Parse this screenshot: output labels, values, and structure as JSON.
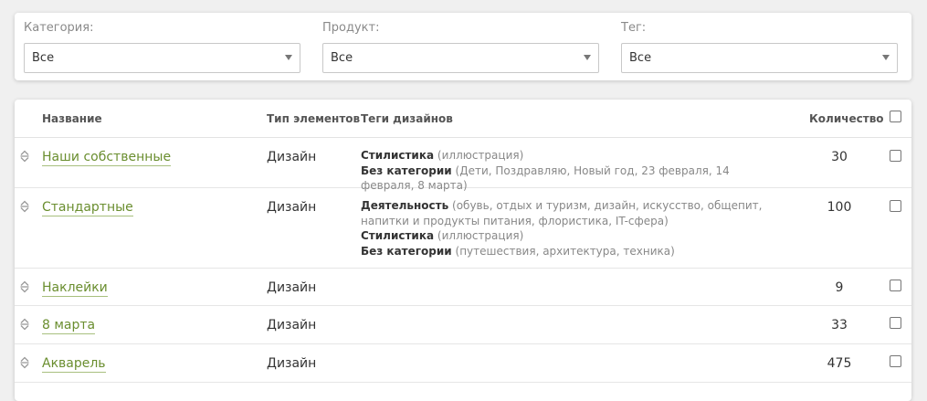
{
  "filters": {
    "category": {
      "label": "Категория:",
      "value": "Все"
    },
    "product": {
      "label": "Продукт:",
      "value": "Все"
    },
    "tag": {
      "label": "Тег:",
      "value": "Все"
    }
  },
  "table": {
    "headers": {
      "name": "Название",
      "type": "Тип элементов",
      "tags": "Теги дизайнов",
      "qty": "Количество"
    },
    "rows": [
      {
        "name": "Наши собственные",
        "type": "Дизайн",
        "tags": [
          {
            "key": "Стилистика",
            "values": "(иллюстрация)"
          },
          {
            "key": "Без категории",
            "values": "(Дети, Поздравляю, Новый год, 23 февраля, 14 февраля, 8 марта)"
          }
        ],
        "qty": "30"
      },
      {
        "name": "Стандартные",
        "type": "Дизайн",
        "tags": [
          {
            "key": "Деятельность",
            "values": "(обувь, отдых и туризм, дизайн, искусство, общепит, напитки и продукты питания, флористика, IT-сфера)"
          },
          {
            "key": "Стилистика",
            "values": "(иллюстрация)"
          },
          {
            "key": "Без категории",
            "values": "(путешествия, архитектура, техника)"
          }
        ],
        "qty": "100"
      },
      {
        "name": "Наклейки",
        "type": "Дизайн",
        "tags": [],
        "qty": "9"
      },
      {
        "name": "8 марта",
        "type": "Дизайн",
        "tags": [],
        "qty": "33"
      },
      {
        "name": "Акварель",
        "type": "Дизайн",
        "tags": [],
        "qty": "475"
      }
    ]
  },
  "colors": {
    "link": "#6a8e2f",
    "link_underline": "#a8c07e",
    "background": "#f0f0f0"
  },
  "icons": {
    "row_handle": "sort-handle-icon",
    "select_caret": "caret-down-icon"
  }
}
